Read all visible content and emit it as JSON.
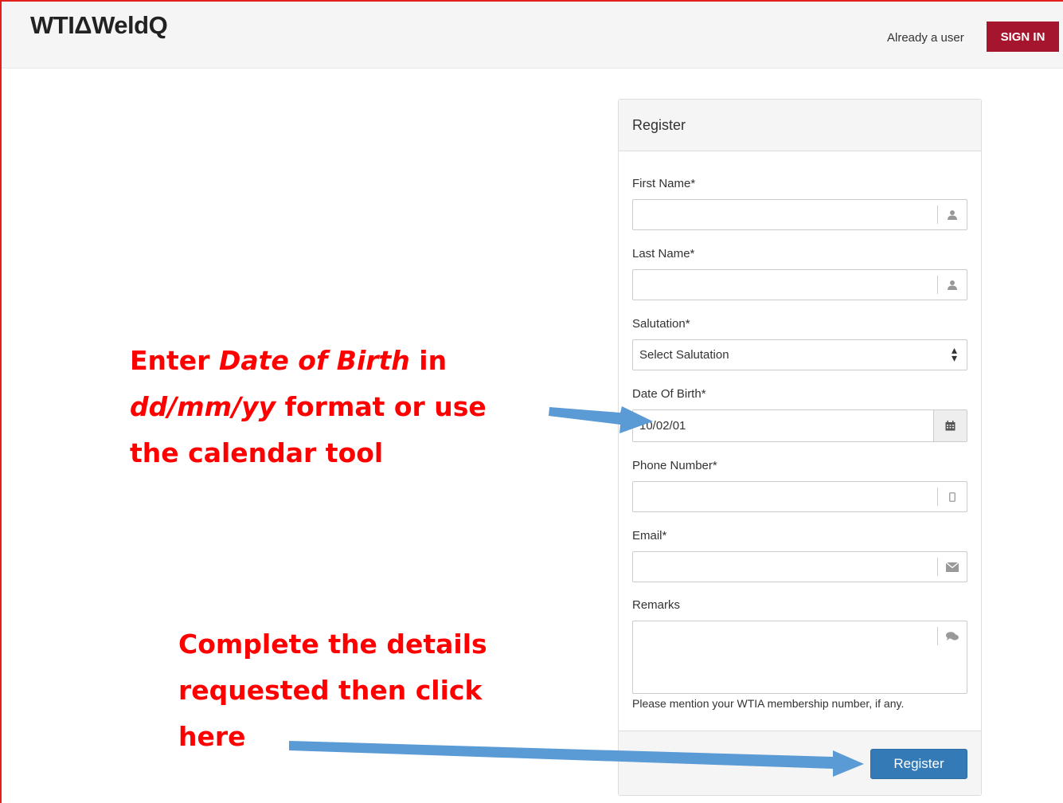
{
  "header": {
    "logo": "WTIΔWeldQ",
    "already_user": "Already a user",
    "signin_label": "SIGN IN"
  },
  "form": {
    "title": "Register",
    "first_name": {
      "label": "First Name*",
      "value": "",
      "icon": "user-icon"
    },
    "last_name": {
      "label": "Last Name*",
      "value": "",
      "icon": "user-icon"
    },
    "salutation": {
      "label": "Salutation*",
      "selected": "Select Salutation"
    },
    "dob": {
      "label": "Date Of Birth*",
      "value": "10/02/01",
      "icon": "calendar-icon"
    },
    "phone": {
      "label": "Phone Number*",
      "value": "",
      "icon": "mobile-icon"
    },
    "email": {
      "label": "Email*",
      "value": "",
      "icon": "envelope-icon"
    },
    "remarks": {
      "label": "Remarks",
      "value": "",
      "icon": "comments-icon",
      "help": "Please mention your WTIA membership number, if any."
    },
    "submit_label": "Register"
  },
  "annotations": {
    "dob_line1_a": "Enter ",
    "dob_line1_em": "Date of Birth",
    "dob_line1_b": " in",
    "dob_line2_em": "dd/mm/yy",
    "dob_line2_b": " format or use",
    "dob_line3": "the calendar tool",
    "register_line1": "Complete the details",
    "register_line2": "requested then click",
    "register_line3": "here"
  },
  "colors": {
    "brand_red": "#a5152d",
    "annotation_red": "#ff0000",
    "primary_blue": "#337ab7",
    "arrow_blue": "#5b9bd5"
  }
}
